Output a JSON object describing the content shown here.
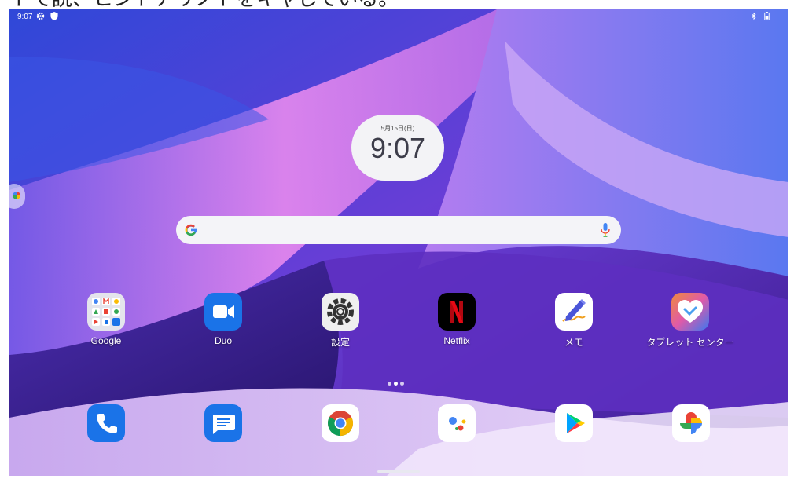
{
  "caption": "トで読、ヒントアリノトをキャしている。",
  "status_bar": {
    "time": "9:07",
    "icons": [
      "gear-icon",
      "shield-icon",
      "bluetooth-icon",
      "battery-icon"
    ]
  },
  "clock": {
    "date": "5月15日(日)",
    "time": "9:07"
  },
  "search": {
    "logo": "google-g-icon",
    "mic": "mic-icon"
  },
  "apps": [
    {
      "label": "Google",
      "icon": "google-folder-icon"
    },
    {
      "label": "Duo",
      "icon": "duo-camera-icon"
    },
    {
      "label": "設定",
      "icon": "settings-gear-icon"
    },
    {
      "label": "Netflix",
      "icon": "netflix-icon"
    },
    {
      "label": "メモ",
      "icon": "memo-pen-icon"
    },
    {
      "label": "タブレット センター",
      "icon": "tablet-center-heart-icon"
    }
  ],
  "dock": [
    {
      "icon": "phone-icon"
    },
    {
      "icon": "messages-icon"
    },
    {
      "icon": "chrome-icon"
    },
    {
      "icon": "assistant-icon"
    },
    {
      "icon": "play-store-icon"
    },
    {
      "icon": "photos-pinwheel-icon"
    }
  ],
  "colors": {
    "wallpaper_blue": "#3d4fe0",
    "wallpaper_purple": "#8a3ad8",
    "wallpaper_pink": "#e07ce8",
    "netflix_red": "#e50914",
    "duo_blue": "#1a73e8"
  }
}
